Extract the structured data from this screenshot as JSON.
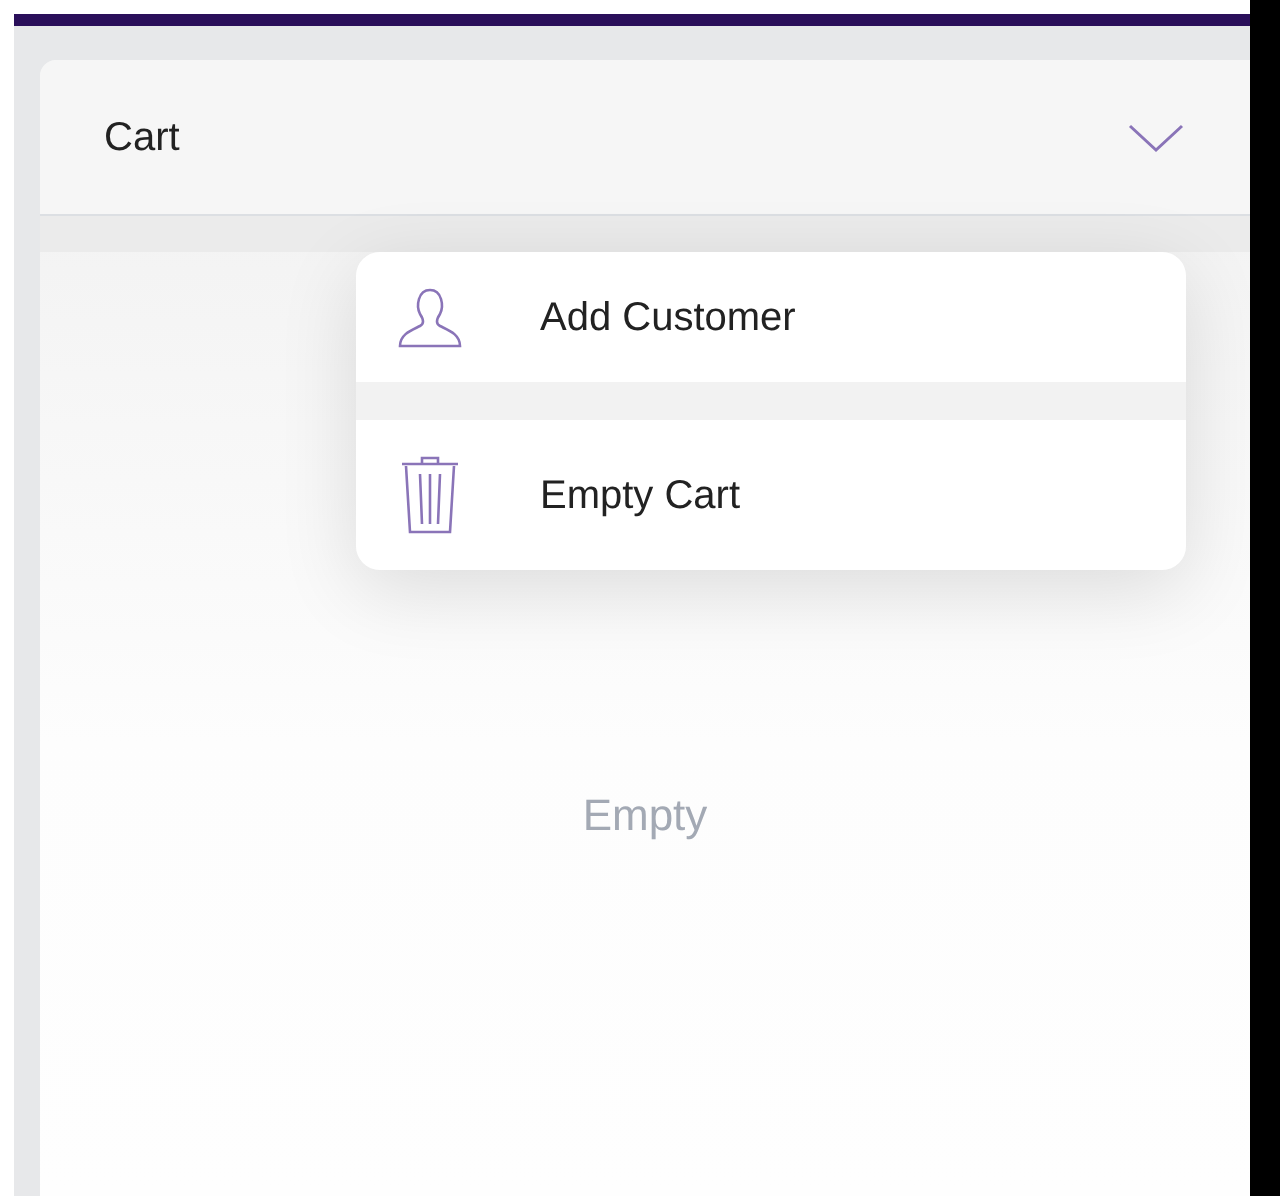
{
  "header": {
    "title": "Cart",
    "expanded": true
  },
  "menu": [
    {
      "kind": "person",
      "label": "Add Customer"
    },
    {
      "kind": "trash",
      "label": "Empty Cart"
    }
  ],
  "empty_text": "Empty"
}
